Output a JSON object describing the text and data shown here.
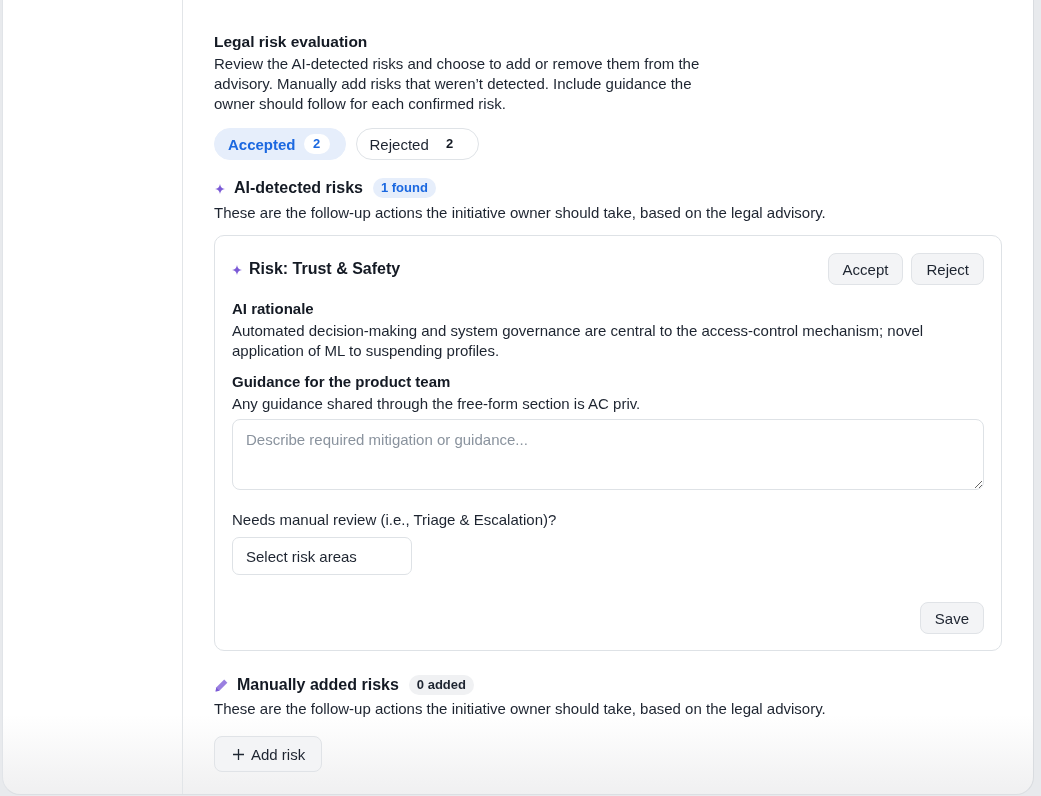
{
  "section": {
    "title": "Legal risk evaluation",
    "description": "Review the AI-detected risks and choose to add or remove them from the advisory. Manually add risks that weren’t detected. Include guidance the owner should follow for each confirmed risk."
  },
  "tabs": [
    {
      "label": "Accepted",
      "count": "2",
      "selected": true
    },
    {
      "label": "Rejected",
      "count": "2",
      "selected": false
    }
  ],
  "ai_detected": {
    "title": "AI-detected risks",
    "badge": "1 found",
    "description": "These are the follow-up actions the initiative owner should take, based on the legal advisory.",
    "risks": [
      {
        "title": "Risk: Trust & Safety",
        "actions": [
          "Accept",
          "Reject"
        ],
        "rationale_label": "AI rationale",
        "rationale": "Automated decision-making and system governance are central to the access-control mechanism; novel application of ML to suspending profiles.",
        "guidance_label": "Guidance for the product team",
        "guidance_note": "Any guidance shared through the free-form section is AC priv.",
        "guidance_field": {
          "placeholder": "Describe required mitigation or guidance..."
        },
        "review_label": "Needs manual review (i.e., Triage & Escalation)?",
        "review_select": {
          "value": "Select risk areas"
        },
        "save": "Save"
      }
    ]
  },
  "manual": {
    "title": "Manually added risks",
    "badge": "0 added",
    "description": "These are the follow-up actions the initiative owner should take, based on the legal advisory.",
    "add_button": "Add risk"
  }
}
